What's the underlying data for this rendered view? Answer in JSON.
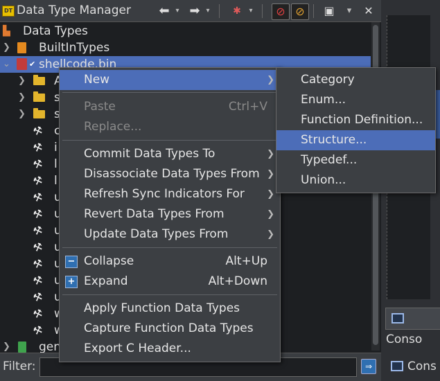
{
  "panel": {
    "title": "Data Type Manager",
    "toolbar": {
      "back_icon": "arrow-left-icon",
      "forward_icon": "arrow-right-icon",
      "caret": "▾",
      "close": "✕"
    }
  },
  "tree": {
    "root_label": "Data Types",
    "builtin_label": "BuiltInTypes",
    "archive_label": "shellcode.bin",
    "folder_letters": [
      "A",
      "s",
      "s"
    ],
    "item_letters": [
      "c",
      "i",
      "l",
      "l",
      "u",
      "u",
      "u",
      "u",
      "u",
      "u",
      "u",
      "w",
      "w"
    ],
    "generic_label": "gen"
  },
  "context_menu": {
    "new": "New",
    "paste": "Paste",
    "paste_shortcut": "Ctrl+V",
    "replace": "Replace...",
    "commit": "Commit Data Types To",
    "disassociate": "Disassociate Data Types From",
    "refresh": "Refresh Sync Indicators For",
    "revert": "Revert Data Types From",
    "update": "Update Data Types From",
    "collapse": "Collapse",
    "collapse_shortcut": "Alt+Up",
    "expand": "Expand",
    "expand_shortcut": "Alt+Down",
    "apply": "Apply Function Data Types",
    "capture": "Capture Function Data Types",
    "export": "Export C Header..."
  },
  "submenu": {
    "category": "Category",
    "enum": "Enum...",
    "function_definition": "Function Definition...",
    "structure": "Structure...",
    "typedef": "Typedef...",
    "union": "Union..."
  },
  "filter": {
    "label": "Filter:",
    "value": ""
  },
  "side": {
    "console_tab_1": "Conso",
    "console_tab_2": "Cons"
  },
  "colors": {
    "selection": "#4c6db8",
    "menu_bg": "#3c3f43",
    "tree_bg": "#1d1f22"
  }
}
